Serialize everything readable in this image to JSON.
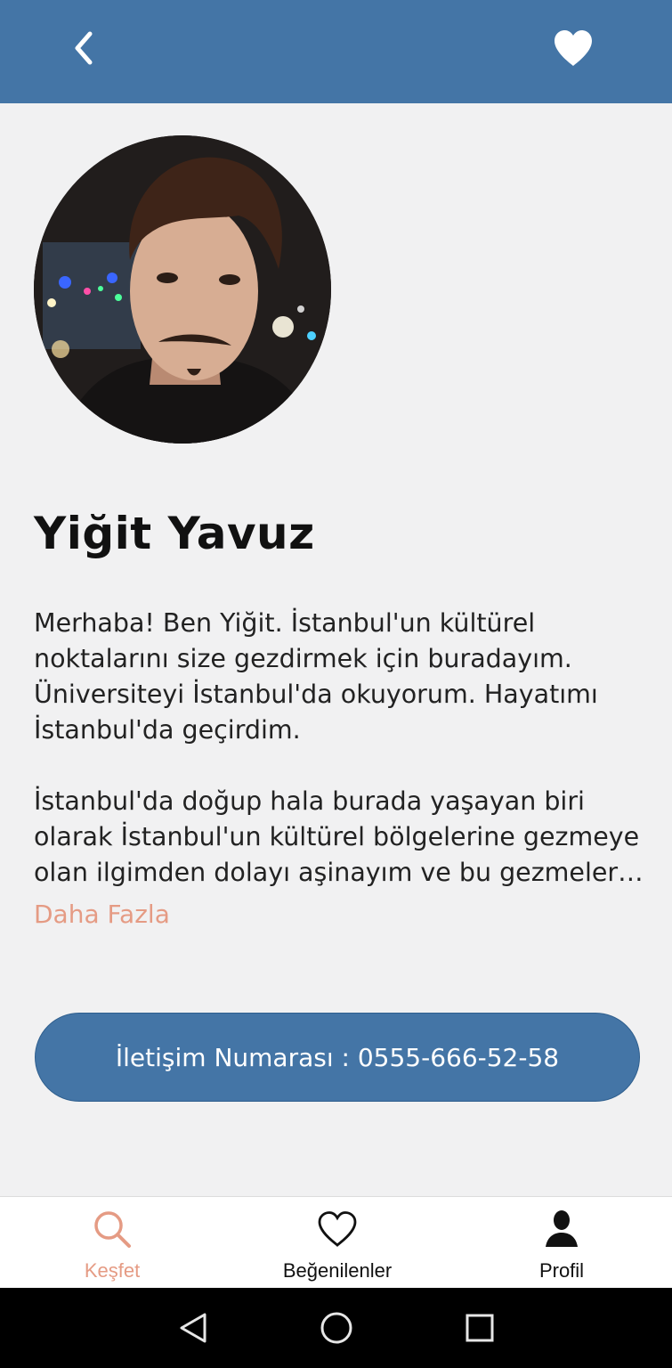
{
  "header": {
    "back_icon": "chevron-left-icon",
    "favorite_icon": "heart-filled-icon",
    "bg_color": "#4475a6"
  },
  "profile": {
    "name": "Yiğit Yavuz",
    "bio_paragraph_1": "Merhaba! Ben Yiğit. İstanbul'un kültürel noktalarını size gezdirmek için buradayım. Üniversiteyi İstanbul'da okuyorum. Hayatımı İstanbul'da geçirdim.",
    "bio_paragraph_2": "İstanbul'da doğup hala burada yaşayan biri olarak İstanbul'un kültürel bölgelerine gezmeye olan ilgimden dolayı aşinayım ve bu gezmeleri t...",
    "more_label": "Daha Fazla",
    "contact_label": "İletişim Numarası : 0555-666-52-58"
  },
  "tabs": [
    {
      "label": "Keşfet",
      "icon": "search-icon",
      "active": true
    },
    {
      "label": "Beğenilenler",
      "icon": "heart-outline-icon",
      "active": false
    },
    {
      "label": "Profil",
      "icon": "user-icon",
      "active": false
    }
  ],
  "system_nav": {
    "back_icon": "triangle-back-icon",
    "home_icon": "circle-home-icon",
    "recents_icon": "square-recents-icon"
  },
  "colors": {
    "accent": "#e59b84",
    "primary": "#4475a6",
    "background": "#f1f1f2"
  }
}
